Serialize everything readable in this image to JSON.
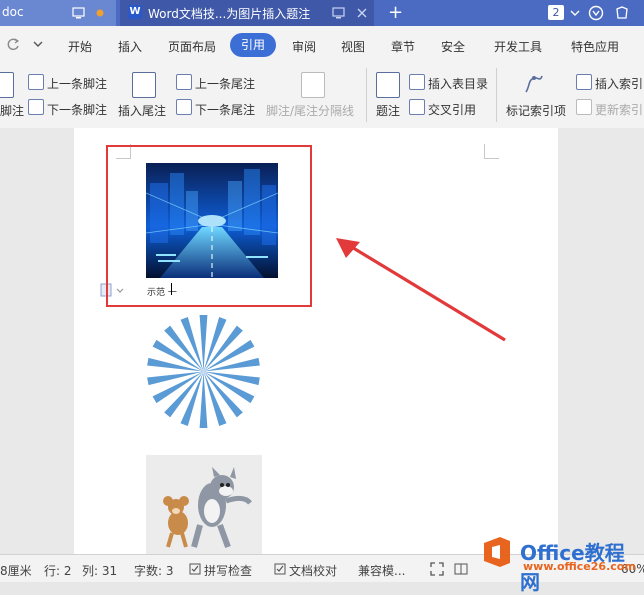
{
  "titlebar": {
    "inactive_tab": "doc",
    "active_tab": "Word文档技...为图片插入题注",
    "new_tab": "+",
    "badge": "2"
  },
  "menu": {
    "items": [
      "开始",
      "插入",
      "页面布局",
      "引用",
      "审阅",
      "视图",
      "章节",
      "安全",
      "开发工具",
      "特色应用"
    ],
    "active": "引用"
  },
  "ribbon": {
    "footnote_left": "脚注",
    "prev_footnote": "上一条脚注",
    "next_footnote": "下一条脚注",
    "insert_endnote": "插入尾注",
    "prev_endnote": "上一条尾注",
    "next_endnote": "下一条尾注",
    "separator_line": "脚注/尾注分隔线",
    "caption": "题注",
    "insert_table_of_figures": "插入表目录",
    "cross_reference": "交叉引用",
    "mark_index": "标记索引项",
    "insert_index": "插入索引",
    "update_index": "更新索引"
  },
  "document": {
    "caption_text": "示范 一"
  },
  "statusbar": {
    "position": "8厘米",
    "row": "行: 2",
    "col": "列: 31",
    "chars": "字数: 3",
    "spell_check": "拼写检查",
    "doc_proof": "文档校对",
    "compat": "兼容模...",
    "zoom": "60%"
  },
  "watermark": {
    "name": "Office教程网",
    "url": "www.office26.com"
  },
  "colors": {
    "accent": "#3c6fd6",
    "annotation": "#e23a3a"
  }
}
